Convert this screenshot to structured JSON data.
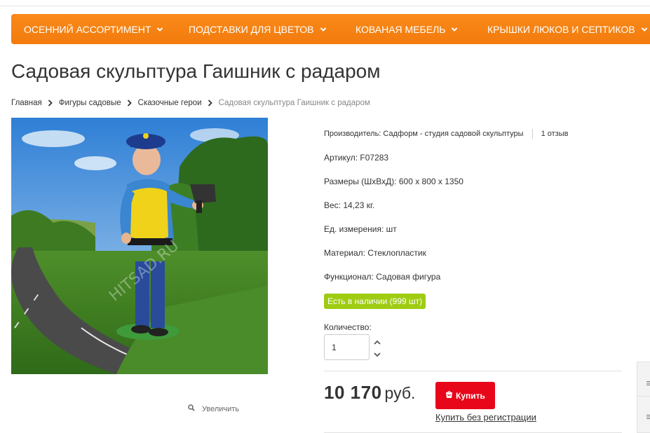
{
  "nav": {
    "items": [
      {
        "label": "Осенний ассортимент"
      },
      {
        "label": "Подставки для цветов"
      },
      {
        "label": "Кованая мебель"
      },
      {
        "label": "Крышки люков и септиков"
      }
    ]
  },
  "page_title": "Садовая скульптура Гаишник с радаром",
  "breadcrumb": [
    {
      "label": "Главная"
    },
    {
      "label": "Фигуры садовые"
    },
    {
      "label": "Сказочные герои"
    },
    {
      "label": "Садовая скульптура Гаишник с радаром"
    }
  ],
  "image": {
    "alt": "Садовая скульптура Гаишник с радаром",
    "watermark": "HITSAD.RU",
    "zoom_label": "Увеличить"
  },
  "attributes": {
    "maker": "Производитель: Садформ - студия садовой скульптуры",
    "reviews": "1 отзыв",
    "article": "Артикул: F07283",
    "size": "Размеры (ШхВхД): 600 x 800 x 1350",
    "weight": "Вес: 14,23 кг.",
    "unit": "Ед. измерения: шт",
    "material": "Материал: Стеклопластик",
    "function": "Функционал: Садовая фигура"
  },
  "stock": {
    "label": "Есть в наличии (999 шт)",
    "color": "#9fcc12"
  },
  "quantity": {
    "label": "Количество:",
    "value": "1"
  },
  "price": {
    "amount": "10 170",
    "currency": "руб."
  },
  "buy": {
    "label": "Купить",
    "color": "#e8061a"
  },
  "quick_buy": {
    "label": "Купить без регистрации"
  },
  "colors": {
    "nav": "#f27b0c",
    "accent": "#e8061a"
  }
}
